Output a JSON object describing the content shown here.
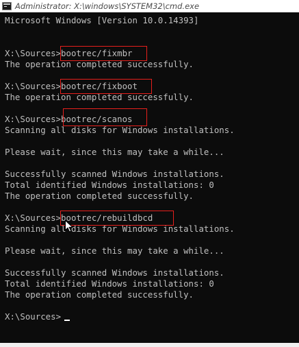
{
  "window": {
    "title": "Administrator: X:\\windows\\SYSTEM32\\cmd.exe",
    "icon": "cmd-app-icon"
  },
  "console": {
    "lines": [
      "Microsoft Windows [Version 10.0.14393]",
      "",
      "",
      "X:\\Sources>bootrec/fixmbr",
      "The operation completed successfully.",
      "",
      "X:\\Sources>bootrec/fixboot",
      "The operation completed successfully.",
      "",
      "X:\\Sources>bootrec/scanos",
      "Scanning all disks for Windows installations.",
      "",
      "Please wait, since this may take a while...",
      "",
      "Successfully scanned Windows installations.",
      "Total identified Windows installations: 0",
      "The operation completed successfully.",
      "",
      "X:\\Sources>bootrec/rebuildbcd",
      "Scanning all disks for Windows installations.",
      "",
      "Please wait, since this may take a while...",
      "",
      "Successfully scanned Windows installations.",
      "Total identified Windows installations: 0",
      "The operation completed successfully.",
      "",
      "X:\\Sources>"
    ],
    "highlighted_commands": [
      "bootrec/fixmbr",
      "bootrec/fixboot",
      "bootrec/scanos",
      "bootrec/rebuildbcd"
    ],
    "colors": {
      "background": "#0c0c0c",
      "text": "#c0c0c0",
      "highlight_border": "#e8201c"
    }
  }
}
